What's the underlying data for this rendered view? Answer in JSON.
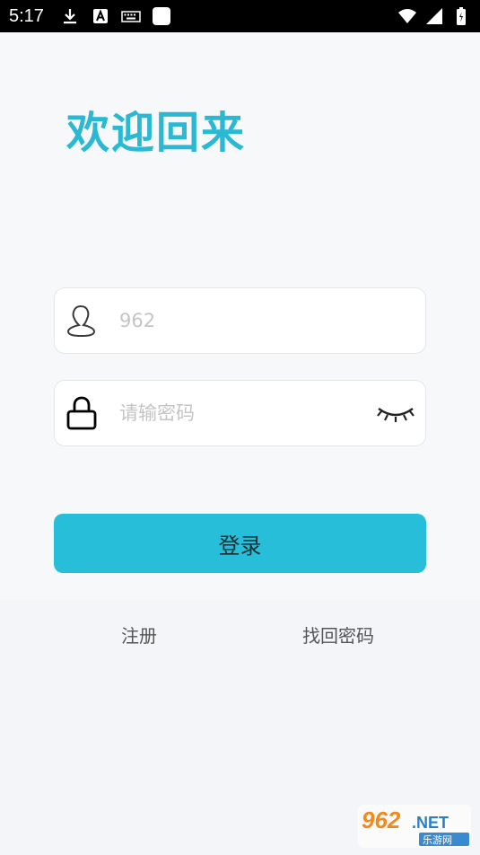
{
  "status_bar": {
    "time": "5:17",
    "icons_left": [
      "download-icon",
      "a-badge-icon",
      "keyboard-icon",
      "square-icon"
    ],
    "icons_right": [
      "wifi-icon",
      "signal-icon",
      "battery-icon"
    ]
  },
  "welcome_title": "欢迎回来",
  "username": {
    "value": "",
    "placeholder": "962",
    "icon": "user-icon"
  },
  "password": {
    "value": "",
    "placeholder": "请输密码",
    "icon": "lock-icon",
    "toggle_icon": "eye-closed-icon"
  },
  "login_button": "登录",
  "links": {
    "register": "注册",
    "forgot_password": "找回密码"
  },
  "watermark": {
    "text": "962.NET",
    "subtext": "乐游网"
  },
  "colors": {
    "accent": "#26bed9",
    "title": "#2bb8d3",
    "background": "#f7f8fa"
  }
}
